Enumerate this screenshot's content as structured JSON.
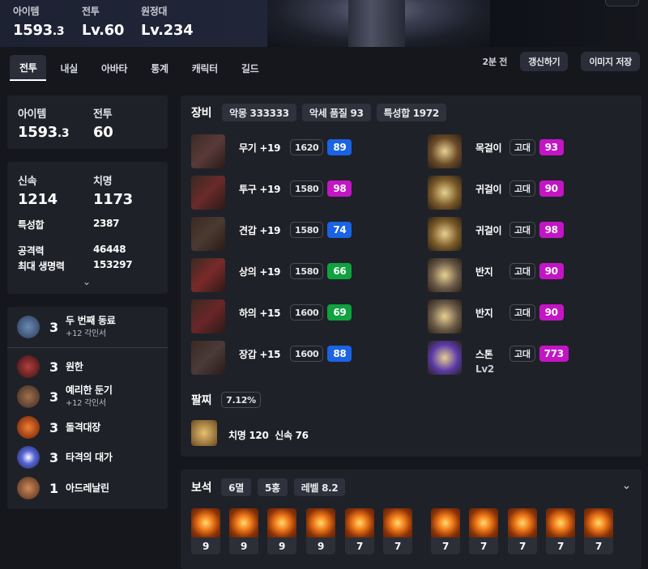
{
  "header": {
    "stats": [
      {
        "label": "아이템",
        "value": "1593",
        "decimal": ".3"
      },
      {
        "label": "전투",
        "value": "Lv.60"
      },
      {
        "label": "원정대",
        "value": "Lv.234"
      }
    ]
  },
  "tabs": [
    "전투",
    "내실",
    "아바타",
    "통계",
    "캐릭터",
    "길드"
  ],
  "toolbar": {
    "ago": "2분 전",
    "refresh": "갱신하기",
    "save_image": "이미지 저장"
  },
  "summary": {
    "item_label": "아이템",
    "item_value": "1593",
    "item_decimal": ".3",
    "combat_label": "전투",
    "combat_value": "60"
  },
  "stats": {
    "swift_label": "신속",
    "swift_value": "1214",
    "crit_label": "치명",
    "crit_value": "1173",
    "trait_label": "특성합",
    "trait_value": "2387",
    "atk_label": "공격력",
    "atk_value": "46448",
    "hp_label": "최대 생명력",
    "hp_value": "153297"
  },
  "engravings": [
    {
      "level": "3",
      "name": "두 번째 동료",
      "sub": "+12 각인서",
      "color": "#3a5a7a"
    },
    {
      "level": "3",
      "name": "원한",
      "sub": "",
      "color": "#7a2a2a"
    },
    {
      "level": "3",
      "name": "예리한 둔기",
      "sub": "+12 각인서",
      "color": "#6a4a3a"
    },
    {
      "level": "3",
      "name": "돌격대장",
      "sub": "",
      "color": "#a8441a"
    },
    {
      "level": "3",
      "name": "타격의 대가",
      "sub": "",
      "color": "#5a68d8"
    },
    {
      "level": "1",
      "name": "아드레날린",
      "sub": "",
      "color": "#8a5a3a"
    }
  ],
  "equipment": {
    "title": "장비",
    "chips": [
      "악몽 333333",
      "악세 품질 93",
      "특성합 1972"
    ],
    "left": [
      {
        "name": "무기 +19",
        "ilvl": "1620",
        "quality": "89",
        "qcolor": "blue",
        "thumb": "#5a3a3a"
      },
      {
        "name": "투구 +19",
        "ilvl": "1580",
        "quality": "98",
        "qcolor": "pink",
        "thumb": "#6a2a2a"
      },
      {
        "name": "견갑 +19",
        "ilvl": "1580",
        "quality": "74",
        "qcolor": "blue",
        "thumb": "#4a3a30"
      },
      {
        "name": "상의 +19",
        "ilvl": "1580",
        "quality": "66",
        "qcolor": "green",
        "thumb": "#7a2a28"
      },
      {
        "name": "하의 +15",
        "ilvl": "1600",
        "quality": "69",
        "qcolor": "green",
        "thumb": "#6a2628"
      },
      {
        "name": "장갑 +15",
        "ilvl": "1600",
        "quality": "88",
        "qcolor": "blue",
        "thumb": "#4a3a38"
      }
    ],
    "right": [
      {
        "name": "목걸이",
        "tier": "고대",
        "quality": "93",
        "thumb": "#6a4a28"
      },
      {
        "name": "귀걸이",
        "tier": "고대",
        "quality": "90",
        "thumb": "#7a5a28"
      },
      {
        "name": "귀걸이",
        "tier": "고대",
        "quality": "98",
        "thumb": "#7a5a28"
      },
      {
        "name": "반지",
        "tier": "고대",
        "quality": "90",
        "thumb": "#6a5a48"
      },
      {
        "name": "반지",
        "tier": "고대",
        "quality": "90",
        "thumb": "#6a5a48"
      },
      {
        "name": "스톤",
        "tier": "고대",
        "quality": "773",
        "thumb": "#5a3aa8",
        "sub": "Lv2"
      }
    ]
  },
  "bracelet": {
    "title": "팔찌",
    "percent": "7.12%",
    "effects": "치명 120  신속 76"
  },
  "gems": {
    "title": "보석",
    "chips": [
      "6멸",
      "5홍",
      "레벨 8.2"
    ],
    "levels": [
      "9",
      "9",
      "9",
      "9",
      "7",
      "7",
      "7",
      "7",
      "7",
      "7",
      "7"
    ]
  }
}
